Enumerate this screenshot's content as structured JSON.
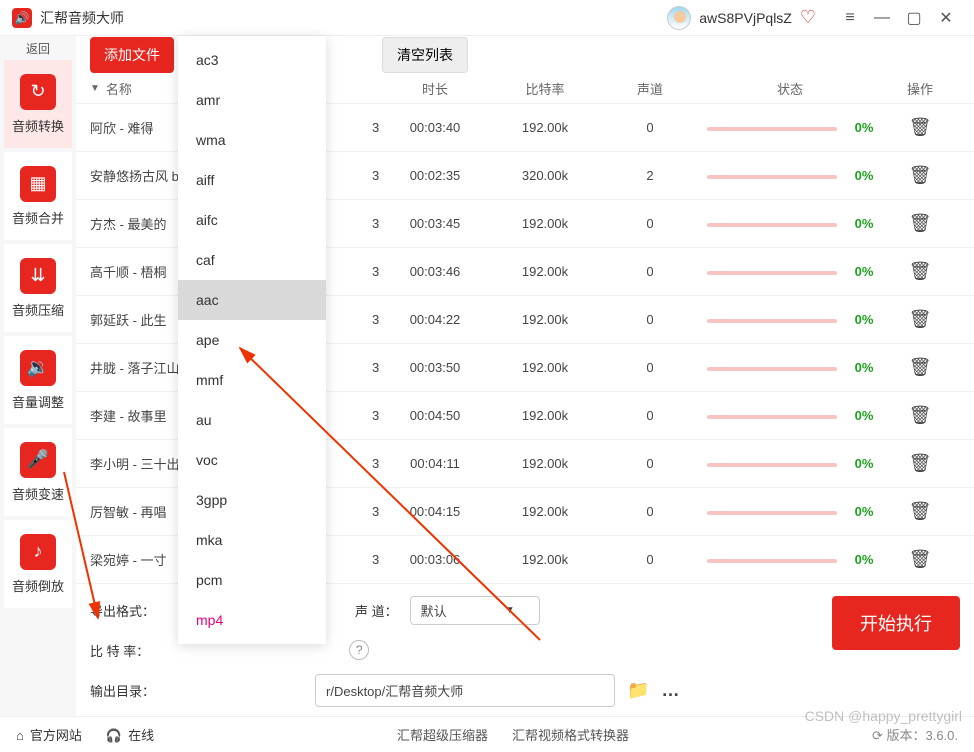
{
  "titlebar": {
    "appname": "汇帮音频大师",
    "username": "awS8PVjPqlsZ"
  },
  "sidebar": {
    "back": "返回",
    "items": [
      {
        "label": "音频转换"
      },
      {
        "label": "音频合并"
      },
      {
        "label": "音频压缩"
      },
      {
        "label": "音量调整"
      },
      {
        "label": "音频变速"
      },
      {
        "label": "音频倒放"
      }
    ]
  },
  "toolbar": {
    "add": "添加文件",
    "clear": "清空列表"
  },
  "table": {
    "headers": {
      "name": "名称",
      "dur": "时长",
      "bit": "比特率",
      "ch": "声道",
      "stat": "状态",
      "op": "操作"
    },
    "frag": "3",
    "rows": [
      {
        "name": "阿欣 - 难得",
        "dur": "00:03:40",
        "bit": "192.00k",
        "ch": "0",
        "pct": "0%"
      },
      {
        "name": "安静悠扬古风 b",
        "dur": "00:02:35",
        "bit": "320.00k",
        "ch": "2",
        "pct": "0%"
      },
      {
        "name": "方杰 - 最美的",
        "dur": "00:03:45",
        "bit": "192.00k",
        "ch": "0",
        "pct": "0%"
      },
      {
        "name": "高千顺 - 梧桐",
        "dur": "00:03:46",
        "bit": "192.00k",
        "ch": "0",
        "pct": "0%"
      },
      {
        "name": "郭延跃 - 此生",
        "dur": "00:04:22",
        "bit": "192.00k",
        "ch": "0",
        "pct": "0%"
      },
      {
        "name": "井胧 - 落子江山",
        "dur": "00:03:50",
        "bit": "192.00k",
        "ch": "0",
        "pct": "0%"
      },
      {
        "name": "李建 - 故事里",
        "dur": "00:04:50",
        "bit": "192.00k",
        "ch": "0",
        "pct": "0%"
      },
      {
        "name": "李小明 - 三十出",
        "dur": "00:04:11",
        "bit": "192.00k",
        "ch": "0",
        "pct": "0%"
      },
      {
        "name": "厉智敏 - 再唱",
        "dur": "00:04:15",
        "bit": "192.00k",
        "ch": "0",
        "pct": "0%"
      },
      {
        "name": "梁宛婷 - 一寸",
        "dur": "00:03:06",
        "bit": "192.00k",
        "ch": "0",
        "pct": "0%"
      }
    ]
  },
  "bottom": {
    "export_label": "导出格式：",
    "channel_label": "声 道：",
    "channel_value": "默认",
    "bitrate_label": "比 特 率：",
    "outdir_label": "输出目录：",
    "outdir_value": "r/Desktop/汇帮音频大师",
    "start": "开始执行"
  },
  "dropdown": {
    "options": [
      "ac3",
      "amr",
      "wma",
      "aiff",
      "aifc",
      "caf",
      "aac",
      "ape",
      "mmf",
      "au",
      "voc",
      "3gpp",
      "mka",
      "pcm",
      "mp4"
    ],
    "hover_index": 6,
    "pink_index": 14
  },
  "footer": {
    "site": "官方网站",
    "online": "在线",
    "p1": "汇帮超级压缩器",
    "p2": "汇帮视频格式转换器",
    "refresh": "版本：3.6.0."
  },
  "watermark": "CSDN @happy_prettygirl"
}
